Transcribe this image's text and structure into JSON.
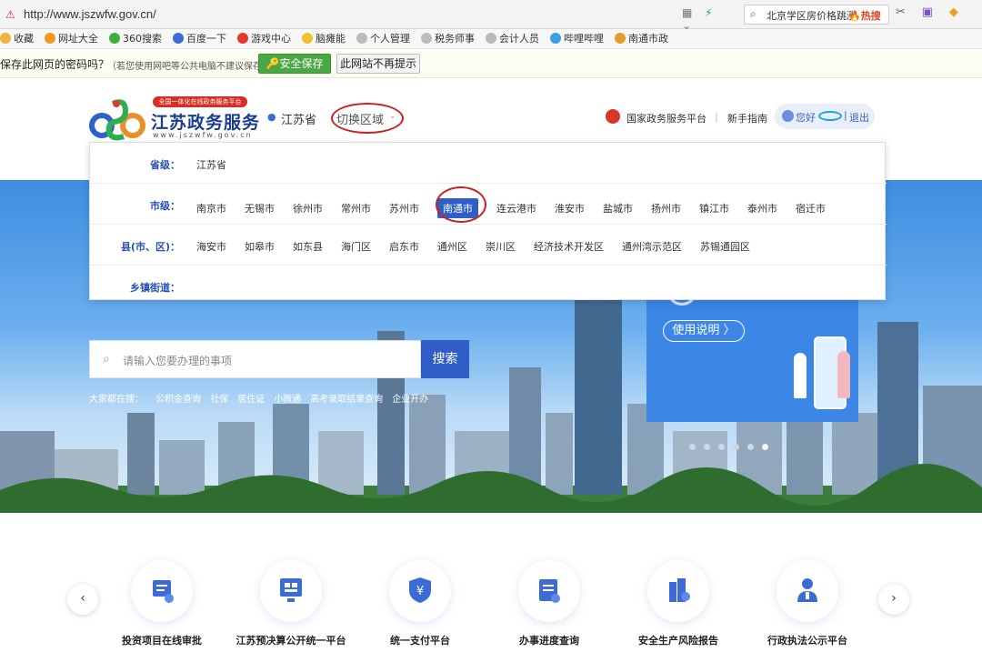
{
  "browser": {
    "url": "http://www.jszwfw.gov.cn/",
    "search_text": "北京学区房价格跳涨",
    "search_hot": "🔥热搜"
  },
  "bookmarks": [
    {
      "label": "收藏",
      "color": "#f1b43a"
    },
    {
      "label": "网址大全",
      "color": "#f19a1c"
    },
    {
      "label": "360搜索",
      "color": "#3fae3b"
    },
    {
      "label": "百度一下",
      "color": "#3c6ad8"
    },
    {
      "label": "游戏中心",
      "color": "#e03a2c"
    },
    {
      "label": "脑瘫能",
      "color": "#f0c030"
    },
    {
      "label": "个人管理",
      "color": "#bbbbbb"
    },
    {
      "label": "税务师事",
      "color": "#bbbbbb"
    },
    {
      "label": "会计人员",
      "color": "#bbbbbb"
    },
    {
      "label": "哔哩哔哩",
      "color": "#3aa0e0"
    },
    {
      "label": "南通市政",
      "color": "#e89a2a"
    }
  ],
  "password_bar": {
    "message": "保存此网页的密码吗？",
    "note": "（若您使用网吧等公共电脑不建议保存）",
    "save_label": "安全保存",
    "never_label": "此网站不再提示"
  },
  "header": {
    "badge": "全国一体化在线政务服务平台",
    "site_title": "江苏政务服务",
    "site_url": "www.jszwfw.gov.cn",
    "location": "江苏省",
    "switch_region": "切换区域",
    "national_platform": "国家政务服务平台",
    "separator": "|",
    "guide": "新手指南",
    "hello": "您好",
    "pipe": "|",
    "logout": "退出"
  },
  "region_dropdown": {
    "province_label": "省级：",
    "province": "江苏省",
    "city_label": "市级：",
    "cities": [
      "南京市",
      "无锡市",
      "徐州市",
      "常州市",
      "苏州市",
      "南通市",
      "连云港市",
      "淮安市",
      "盐城市",
      "扬州市",
      "镇江市",
      "泰州市",
      "宿迁市"
    ],
    "selected_city": "南通市",
    "county_label": "县(市、区)：",
    "counties": [
      "海安市",
      "如皋市",
      "如东县",
      "海门区",
      "启东市",
      "通州区",
      "崇川区",
      "经济技术开发区",
      "通州湾示范区",
      "苏锡通园区"
    ],
    "town_label": "乡镇街道："
  },
  "hero": {
    "search_placeholder": "请输入您要办理的事项",
    "search_button": "搜索",
    "hot_label": "大家都在搜：",
    "hot_items": [
      "公积金查询",
      "社保",
      "居住证",
      "小微通",
      "高考录取结果查询",
      "企业开办"
    ],
    "promo_button": "使用说明 〉"
  },
  "services": [
    {
      "label": "投资项目在线审批",
      "icon": "approval-icon"
    },
    {
      "label": "江苏预决算公开统一平台",
      "icon": "budget-icon"
    },
    {
      "label": "统一支付平台",
      "icon": "payment-icon"
    },
    {
      "label": "办事进度查询",
      "icon": "progress-icon"
    },
    {
      "label": "安全生产风险报告",
      "icon": "safety-icon"
    },
    {
      "label": "行政执法公示平台",
      "icon": "enforcement-icon"
    }
  ],
  "colors": {
    "brand_blue": "#2f5ec8",
    "title_blue": "#1a3d8f",
    "save_green": "#49a843",
    "annotation_red": "#cc1f1f"
  }
}
